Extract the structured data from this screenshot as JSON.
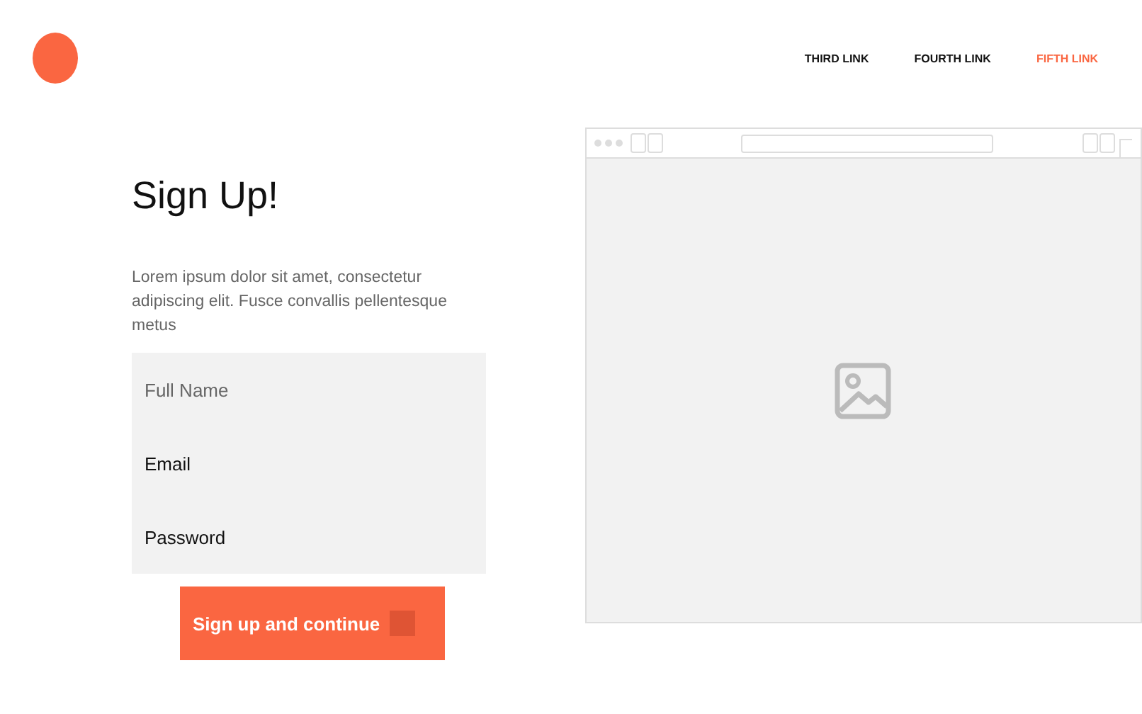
{
  "nav": {
    "links": [
      {
        "label": "THIRD LINK",
        "selected": false
      },
      {
        "label": "FOURTH LINK",
        "selected": false
      },
      {
        "label": "FIFTH LINK",
        "selected": true
      }
    ]
  },
  "heading": "Sign Up!",
  "intro": "Lorem ipsum dolor sit amet, consectetur adipiscing elit. Fusce convallis pellentesque metus",
  "fields": [
    {
      "placeholder": "Full Name"
    },
    {
      "value": "Email"
    },
    {
      "value": "Password"
    }
  ],
  "submit": "Sign up and continue"
}
